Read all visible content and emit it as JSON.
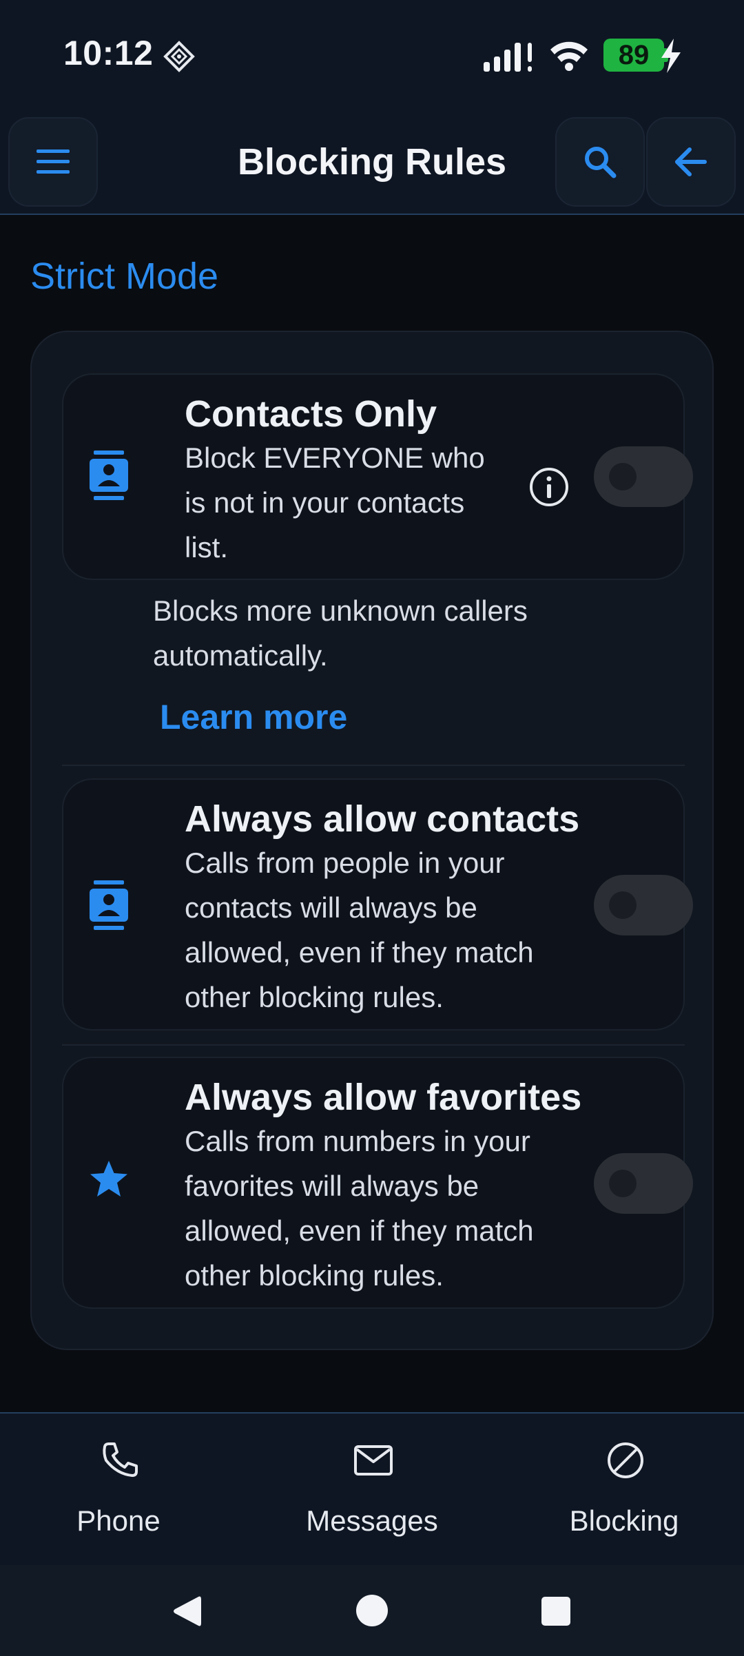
{
  "status_bar": {
    "time": "10:12",
    "battery": "89",
    "battery_color": "#1fb341"
  },
  "app_bar": {
    "title": "Blocking Rules",
    "menu_icon": "menu-icon",
    "search_icon": "search-icon",
    "back_icon": "arrow-back-icon"
  },
  "section": {
    "title": "Strict Mode"
  },
  "rules": {
    "contacts_only": {
      "title": "Contacts Only",
      "description": "Block EVERYONE who is not in your contacts list.",
      "extra": "Blocks more unknown callers automatically.",
      "learn_more": "Learn more",
      "enabled": false,
      "icon": "contact-card-icon"
    },
    "allow_contacts": {
      "title": "Always allow contacts",
      "description": "Calls from people in your contacts will always be allowed, even if they match other blocking rules.",
      "enabled": false,
      "icon": "contact-card-icon"
    },
    "allow_favorites": {
      "title": "Always allow favorites",
      "description": "Calls from numbers in your favorites will always be allowed, even if they match other blocking rules.",
      "enabled": false,
      "icon": "star-icon"
    }
  },
  "bottom_nav": {
    "phone": "Phone",
    "messages": "Messages",
    "blocking": "Blocking"
  },
  "colors": {
    "accent": "#2b8cf0",
    "background": "#090c11",
    "bar": "#0f1623"
  }
}
